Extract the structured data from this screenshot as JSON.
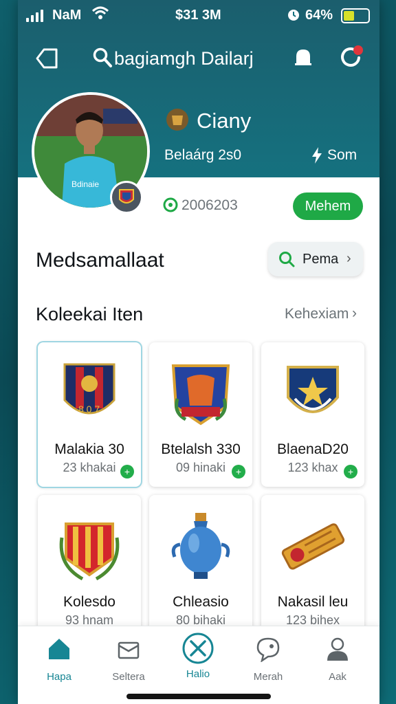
{
  "status_bar": {
    "carrier": "NaM",
    "time": "$31 3M",
    "battery": "64%",
    "battery_level": 0.45,
    "icons": [
      "signal-icon",
      "wifi-icon",
      "alarm-icon",
      "battery-icon"
    ]
  },
  "nav": {
    "title": "bagiamgh Dailarj",
    "icons": [
      "home-icon",
      "search-icon",
      "bell-icon",
      "sync-icon"
    ]
  },
  "profile": {
    "name": "Ciany",
    "level": "Belaárg 2s0",
    "status": "Som",
    "coins": "2006203",
    "member_button": "Mehem",
    "jersey_text": "Bdinaie"
  },
  "section": {
    "title": "Medsamallaat",
    "search_label": "Pema"
  },
  "collection": {
    "title": "Koleekai Iten",
    "see_all": "Kehexiam",
    "items": [
      {
        "name": "Malakia 30",
        "sub": "23 khakai",
        "icon": "club-crest-icon"
      },
      {
        "name": "Btelalsh 330",
        "sub": "09 hinaki",
        "icon": "shield-badge-icon"
      },
      {
        "name": "BlaenaD20",
        "sub": "123 khax",
        "icon": "star-crest-icon"
      },
      {
        "name": "Kolesdo",
        "sub": "93 hnam",
        "icon": "laurel-badge-icon"
      },
      {
        "name": "Chleasio",
        "sub": "80 bihaki",
        "icon": "trophy-vase-icon"
      },
      {
        "name": "Nakasil leu",
        "sub": "123 bihex",
        "icon": "ticket-icon"
      }
    ]
  },
  "tabs": [
    {
      "label": "Hapa",
      "icon": "home-icon"
    },
    {
      "label": "Seltera",
      "icon": "box-icon"
    },
    {
      "label": "Halio",
      "icon": "tools-icon"
    },
    {
      "label": "Merah",
      "icon": "chat-icon"
    },
    {
      "label": "Aak",
      "icon": "user-icon"
    }
  ],
  "colors": {
    "header_teal": "#15717f",
    "accent_green": "#1fa946",
    "tab_active": "#178694"
  }
}
